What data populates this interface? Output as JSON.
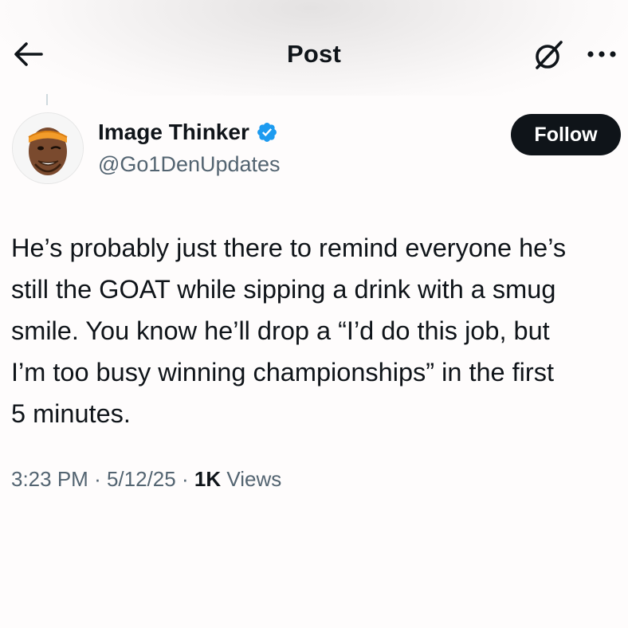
{
  "header": {
    "title": "Post",
    "back_icon": "arrow-left-icon",
    "grok_icon": "grok-icon",
    "more_icon": "more-horizontal-icon"
  },
  "author": {
    "name": "Image Thinker",
    "handle": "@Go1DenUpdates",
    "verified_icon": "verified-badge-icon",
    "verified_color": "#1d9bf0",
    "follow_label": "Follow"
  },
  "post": {
    "text": "He’s probably just there to remind everyone he’s\nstill the GOAT while sipping a drink with a smug\nsmile. You know he’ll drop a “I’d do this job, but\nI’m too busy winning championships” in the first\n5 minutes.",
    "time": "3:23 PM",
    "date": "5/12/25",
    "views_count": "1K",
    "views_label": "Views",
    "separator": "·"
  },
  "colors": {
    "text_primary": "#0f1419",
    "text_secondary": "#536471",
    "follow_bg": "#0f1419",
    "background": "#fefcfc"
  }
}
